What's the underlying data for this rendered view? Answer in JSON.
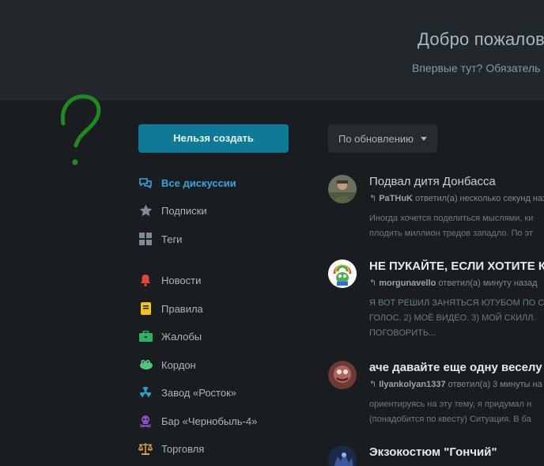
{
  "hero": {
    "title": "Добро пожалов",
    "subtitle": "Впервые тут? Обязатель"
  },
  "sidebar": {
    "start_button": "Нельзя создать",
    "items": [
      {
        "label": "Все дискуссии",
        "icon": "comments-icon",
        "color": "#34a6df",
        "active": true
      },
      {
        "label": "Подписки",
        "icon": "star-icon",
        "color": "#7f8c95"
      },
      {
        "label": "Теги",
        "icon": "tags-grid-icon",
        "color": "#7f8c95"
      },
      {
        "label": "Новости",
        "icon": "bell-icon",
        "color": "#e0463c"
      },
      {
        "label": "Правила",
        "icon": "book-icon",
        "color": "#f2c41c"
      },
      {
        "label": "Жалобы",
        "icon": "briefcase-icon",
        "color": "#2fb363"
      },
      {
        "label": "Кордон",
        "icon": "frog-icon",
        "color": "#52c47e"
      },
      {
        "label": "Завод «Росток»",
        "icon": "radiation-icon",
        "color": "#2aa0c8"
      },
      {
        "label": "Бар «Чернобыль-4»",
        "icon": "skull-icon",
        "color": "#8a4fc9"
      },
      {
        "label": "Торговля",
        "icon": "scales-icon",
        "color": "#d6a33a"
      }
    ]
  },
  "sort": {
    "label": "По обновлению"
  },
  "discussions": [
    {
      "title": "Подвал дитя Донбасса",
      "bold": false,
      "user": "PaTHuK",
      "meta": "ответил(а) несколько секунд наз",
      "excerpt": [
        "Иногда хочется поделиться мыслями, ки",
        "плодить миллион тредов западло. По эт"
      ]
    },
    {
      "title": "НЕ ПУКАЙТЕ, ЕСЛИ ХОТИТЕ К",
      "bold": true,
      "user": "morgunavello",
      "meta": "ответил(а) минуту назад",
      "excerpt": [
        "Я ВОТ РЕШИЛ ЗАНЯТЬСЯ ЮТУБОМ ПО С",
        "ГОЛОС. 2) МОЁ ВИДЕО. 3) МОЙ СКИЛЛ.",
        "ПОГОВОРИТЬ..."
      ]
    },
    {
      "title": "аче давайте еще одну веселу",
      "bold": true,
      "user": "Ilyankolyan1337",
      "meta": "ответил(а) 3 минуты на",
      "excerpt": [
        "ориентируясь на эту тему, я придумал н",
        "(понадобится по квесту) Ситуация. В ба"
      ]
    },
    {
      "title": "Экзокостюм \"Гончий\"",
      "bold": true,
      "user": "",
      "meta": "",
      "excerpt": []
    }
  ]
}
